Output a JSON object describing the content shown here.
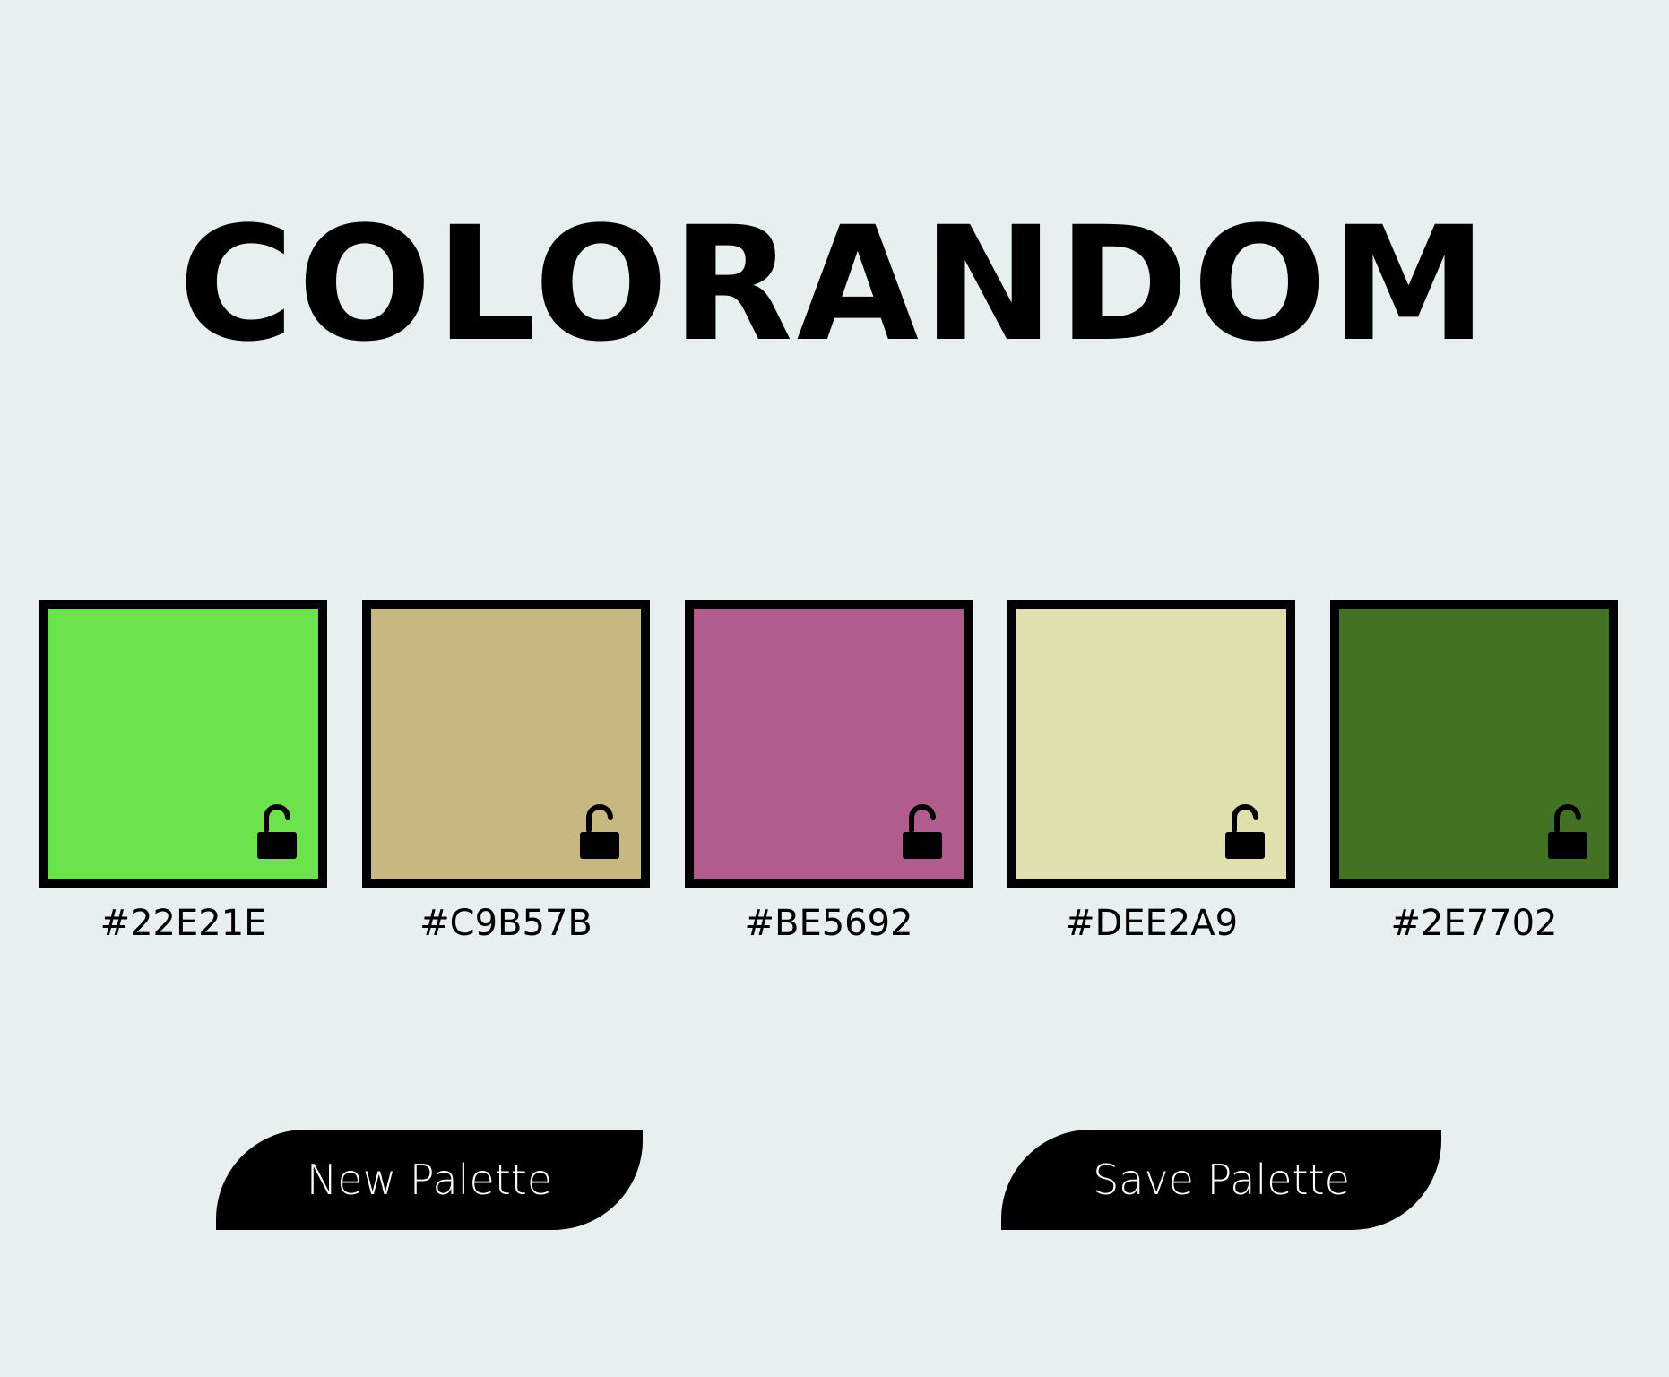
{
  "app": {
    "title": "COLORANDOM"
  },
  "palette": [
    {
      "hex": "#22E21E",
      "color": "#6ce24c",
      "lock_icon": "unlocked-padlock-icon"
    },
    {
      "hex": "#C9B57B",
      "color": "#c7b780",
      "lock_icon": "unlocked-padlock-icon"
    },
    {
      "hex": "#BE5692",
      "color": "#b05d8e",
      "lock_icon": "unlocked-padlock-icon"
    },
    {
      "hex": "#DEE2A9",
      "color": "#dfe0ae",
      "lock_icon": "unlocked-padlock-icon"
    },
    {
      "hex": "#2E7702",
      "color": "#437322",
      "lock_icon": "unlocked-padlock-icon"
    }
  ],
  "actions": {
    "new_label": "New Palette",
    "save_label": "Save Palette"
  },
  "theme": {
    "background": "#e8f0ef",
    "border": "#000000",
    "button_bg": "#000000",
    "button_text": "#ffffff"
  }
}
